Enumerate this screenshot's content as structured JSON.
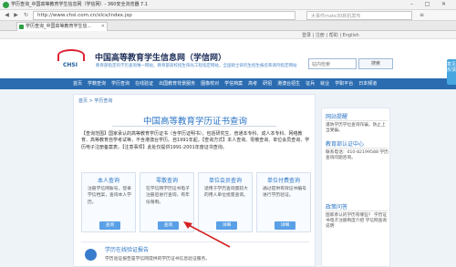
{
  "browser": {
    "window_title": "学历查询_中国高等教育学生信息网（学信网）- 360安全浏览器 7.1",
    "url": "http://www.chsi.com.cn/xlcx/index.jsp",
    "search_placeholder": "大事件mate30新机发布",
    "tab_label": "学历查询_中国高等教育学生信..."
  },
  "site_topbar": {
    "links": "登录 | 注册 | 帮助 | English"
  },
  "site_header": {
    "logo_text": "CHSI",
    "title": "中国高等教育学生信息网（学信网）",
    "subtitle": "教育部指定的学历查询唯一网站，教育部高校招生阳光工程指定网站，全国硕士研究生招生报名和调剂指定网站",
    "search_placeholder": "站内检索",
    "search_button": "搜索"
  },
  "main_nav": [
    "首页",
    "学籍查询",
    "学历查询",
    "在线验证",
    "出国教育背景服务",
    "图像校对",
    "学信档案",
    "高考",
    "研招",
    "港澳台招生",
    "征兵",
    "就业",
    "学职平台",
    "日本频道"
  ],
  "content": {
    "breadcrumb": "首页 > 学历查询",
    "title": "中国高等教育学历证书查询",
    "description": "【查询范围】国家承认的高等教育学历证书（含学历证明书），包括研究生、普通本专科、成人本专科、网络教育、高等教育自学考试等，不含港澳台学历。自1991年起。【查询方式】本人查询、零散查询、单位会员查询、学历电子注册备案表。【注意事项】此处仅提供1991-2001年度证书查询。",
    "cards": [
      {
        "title": "本人查询",
        "text": "注册学信网账号，登录学信档案，查询本人学历。",
        "button": "查询"
      },
      {
        "title": "零散查询",
        "text": "在学信网学历证书电子注册后进行查询，有年份限制。",
        "button": "查询"
      },
      {
        "title": "单位会员查询",
        "text": "适用于学历查询量较大的用人单位批量查询。",
        "button": "详细"
      },
      {
        "title": "单位付费查询",
        "text": "通过提供有效证书编号进行学历验证。",
        "button": "详细"
      }
    ],
    "section2_title": "学历在线验证报告",
    "section2_text": "学历验证报告是学信网提供的学历证书信息验证服务。"
  },
  "sidebar": {
    "notice_title": "网站提醒",
    "notice_text": "谨防学历学位查询诈骗，防止上当受骗。",
    "contact_title": "教育部认证中心",
    "contact_text": "联系电话：010-82199588 学历查询问题咨询。",
    "faq_title": "政策问答",
    "faq_text": "国家承认的学历有哪些？ 学历证书电子注册制度介绍 学信网查询说明"
  },
  "side_tab": "意见反馈"
}
